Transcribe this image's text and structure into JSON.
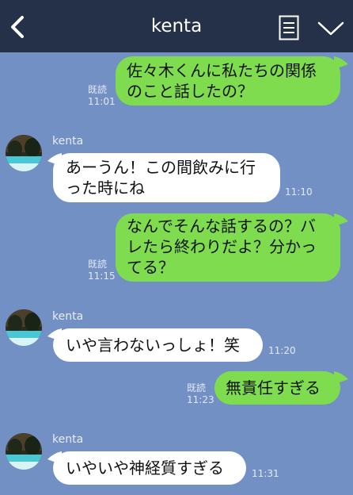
{
  "header": {
    "title": "kenta"
  },
  "messages": [
    {
      "direction": "out",
      "lines": [
        "佐々木くんに私たちの関係",
        "のこと話したの？"
      ],
      "read": "既読",
      "time": "11:01"
    },
    {
      "direction": "in",
      "sender": "kenta",
      "lines": [
        "あーうん！この間飲みに行",
        "った時にね"
      ],
      "time": "11:10"
    },
    {
      "direction": "out",
      "lines": [
        "なんでそんな話するの？バ",
        "レたら終わりだよ？分かっ",
        "てる？"
      ],
      "read": "既読",
      "time": "11:15"
    },
    {
      "direction": "in",
      "sender": "kenta",
      "lines": [
        "いや言わないっしょ！笑"
      ],
      "time": "11:20"
    },
    {
      "direction": "out",
      "lines": [
        "無責任すぎる"
      ],
      "read": "既読",
      "time": "11:23"
    },
    {
      "direction": "in",
      "sender": "kenta",
      "lines": [
        "いやいや神経質すぎる"
      ],
      "time": "11:31"
    }
  ],
  "colors": {
    "background": "#7290c4",
    "header": "#253148",
    "outgoing_bubble": "#7edc4e",
    "incoming_bubble": "#ffffff"
  },
  "icons": {
    "back": "chevron-left-icon",
    "menu": "document-list-icon",
    "expand": "chevron-down-icon"
  }
}
